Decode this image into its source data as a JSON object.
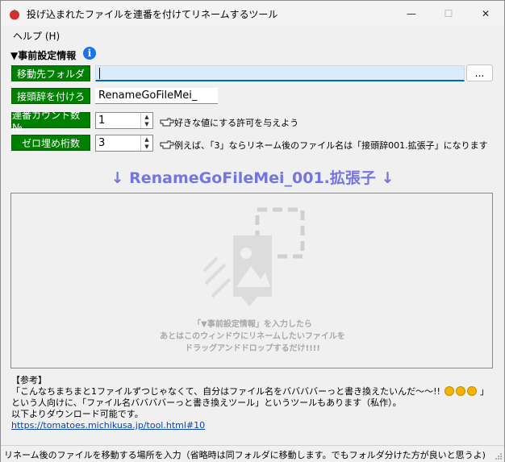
{
  "window": {
    "title": "投げ込まれたファイルを連番を付けてリネームするツール",
    "minimize_glyph": "—",
    "maximize_glyph": "☐",
    "close_glyph": "✕"
  },
  "menu": {
    "help": "ヘルプ (H)"
  },
  "settings": {
    "section_title": "▼事前設定情報",
    "info_glyph": "i",
    "folder_button": "移動先フォルダ",
    "folder_value": "",
    "browse_button": "...",
    "prefix_button": "接頭辞を付けろ",
    "prefix_value": "RenameGoFileMei_",
    "count_button": "連番カウント数№",
    "count_value": "1",
    "count_hint": "好きな値にする許可を与えよう",
    "zero_button": "ゼロ埋め桁数",
    "zero_value": "3",
    "zero_hint": "例えば、「3」ならリネーム後のファイル名は「接頭辞001.拡張子」になります",
    "spin_up": "▲",
    "spin_down": "▼"
  },
  "preview": {
    "text": "↓ RenameGoFileMei_001.拡張子 ↓"
  },
  "dropzone": {
    "line1": "「▼事前設定情報」を入力したら",
    "line2": "あとはこのウィンドウにリネームしたいファイルを",
    "line3": "ドラッグアンドドロップするだけ!!!!"
  },
  "reference": {
    "heading": "【参考】",
    "line1": "「こんなちまちまと1ファイルずつじゃなくて、自分はファイル名をババババーっと書き換えたいんだ〜〜!!",
    "line1_end": "」",
    "line2": "という人向けに、「ファイル名ババババーっと書き換えツール」というツールもあります（私作）。",
    "line3": "以下よりダウンロード可能です。",
    "link": "https://tomatoes.michikusa.jp/tool.html#10"
  },
  "status": {
    "text": "リネーム後のファイルを移動する場所を入力（省略時は同フォルダに移動します。でもフォルダ分けた方が良いと思うよ)"
  },
  "colors": {
    "green_button": "#008000",
    "preview_text": "#7575e0",
    "accent": "#0067c0"
  }
}
